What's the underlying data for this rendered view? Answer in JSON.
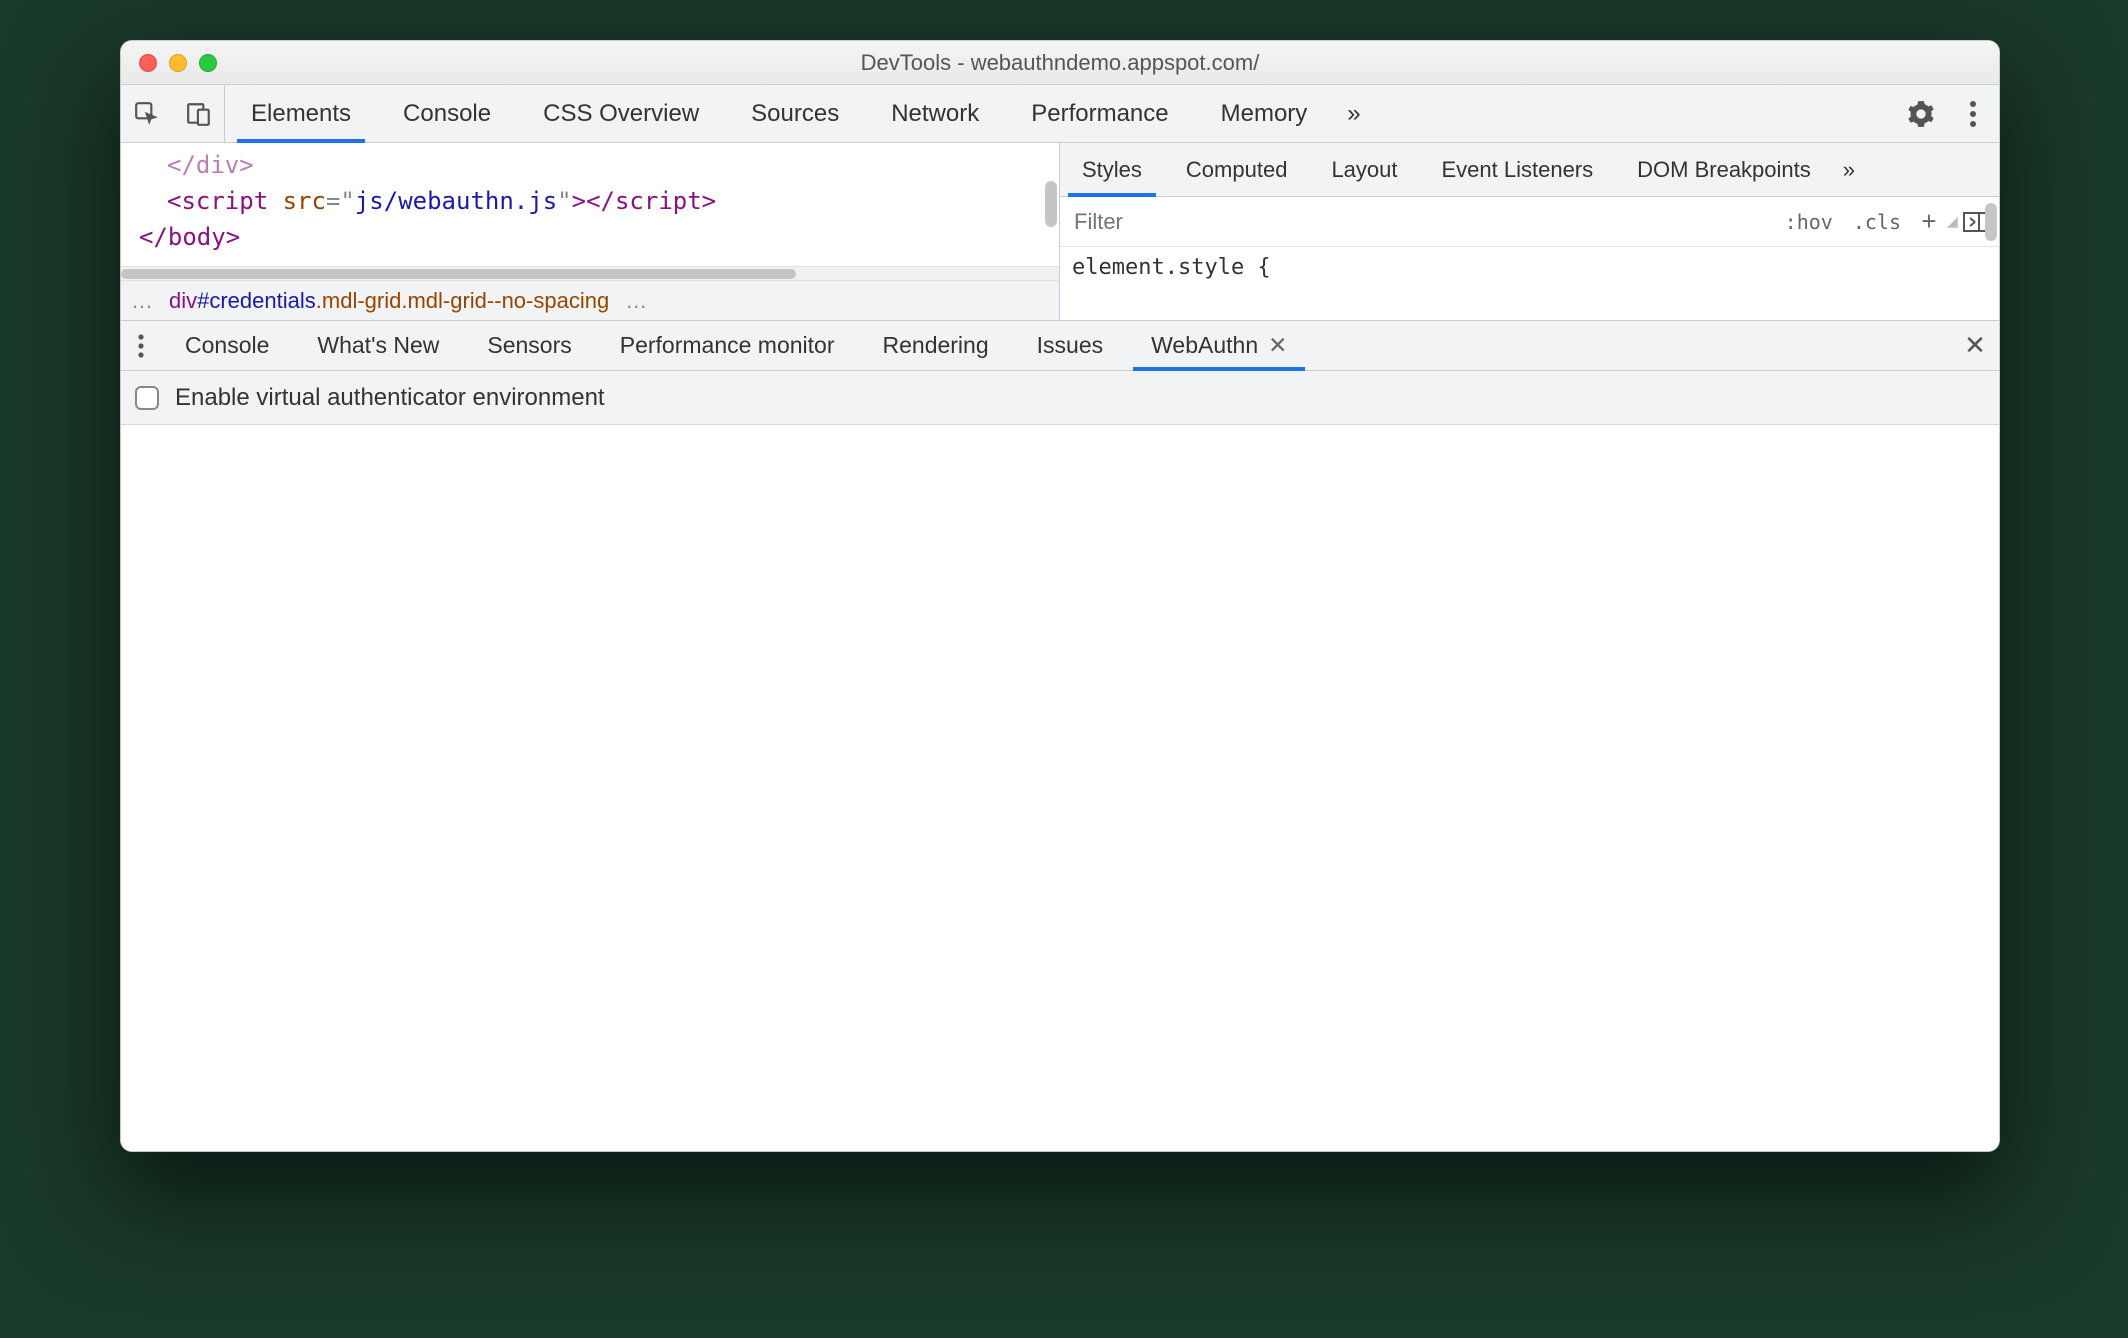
{
  "window": {
    "title": "DevTools - webauthndemo.appspot.com/"
  },
  "mainTabs": {
    "items": [
      "Elements",
      "Console",
      "CSS Overview",
      "Sources",
      "Network",
      "Performance",
      "Memory"
    ],
    "active": "Elements",
    "overflow_glyph": "»"
  },
  "code": {
    "line1": "</div>",
    "line2_open": "<script",
    "line2_attr": " src",
    "line2_eq": "=\"",
    "line2_val": "js/webauthn.js",
    "line2_q2": "\"",
    "line2_close1": ">",
    "line2_close2": "</scr",
    "line2_close3": "ipt>",
    "line3": "</body>"
  },
  "breadcrumb": {
    "before": "…",
    "tag": "div",
    "id": "#credentials",
    "cls1": ".mdl-grid",
    "cls2": ".mdl-grid--no-spacing",
    "after": "…"
  },
  "styles": {
    "tabs": [
      "Styles",
      "Computed",
      "Layout",
      "Event Listeners",
      "DOM Breakpoints"
    ],
    "active": "Styles",
    "overflow_glyph": "»",
    "filter_placeholder": "Filter",
    "hov": ":hov",
    "cls": ".cls",
    "plus": "+",
    "rule": "element.style {"
  },
  "drawer": {
    "tabs": [
      "Console",
      "What's New",
      "Sensors",
      "Performance monitor",
      "Rendering",
      "Issues",
      "WebAuthn"
    ],
    "active": "WebAuthn",
    "close_glyph": "✕"
  },
  "webauthn": {
    "checkbox_label": "Enable virtual authenticator environment"
  }
}
